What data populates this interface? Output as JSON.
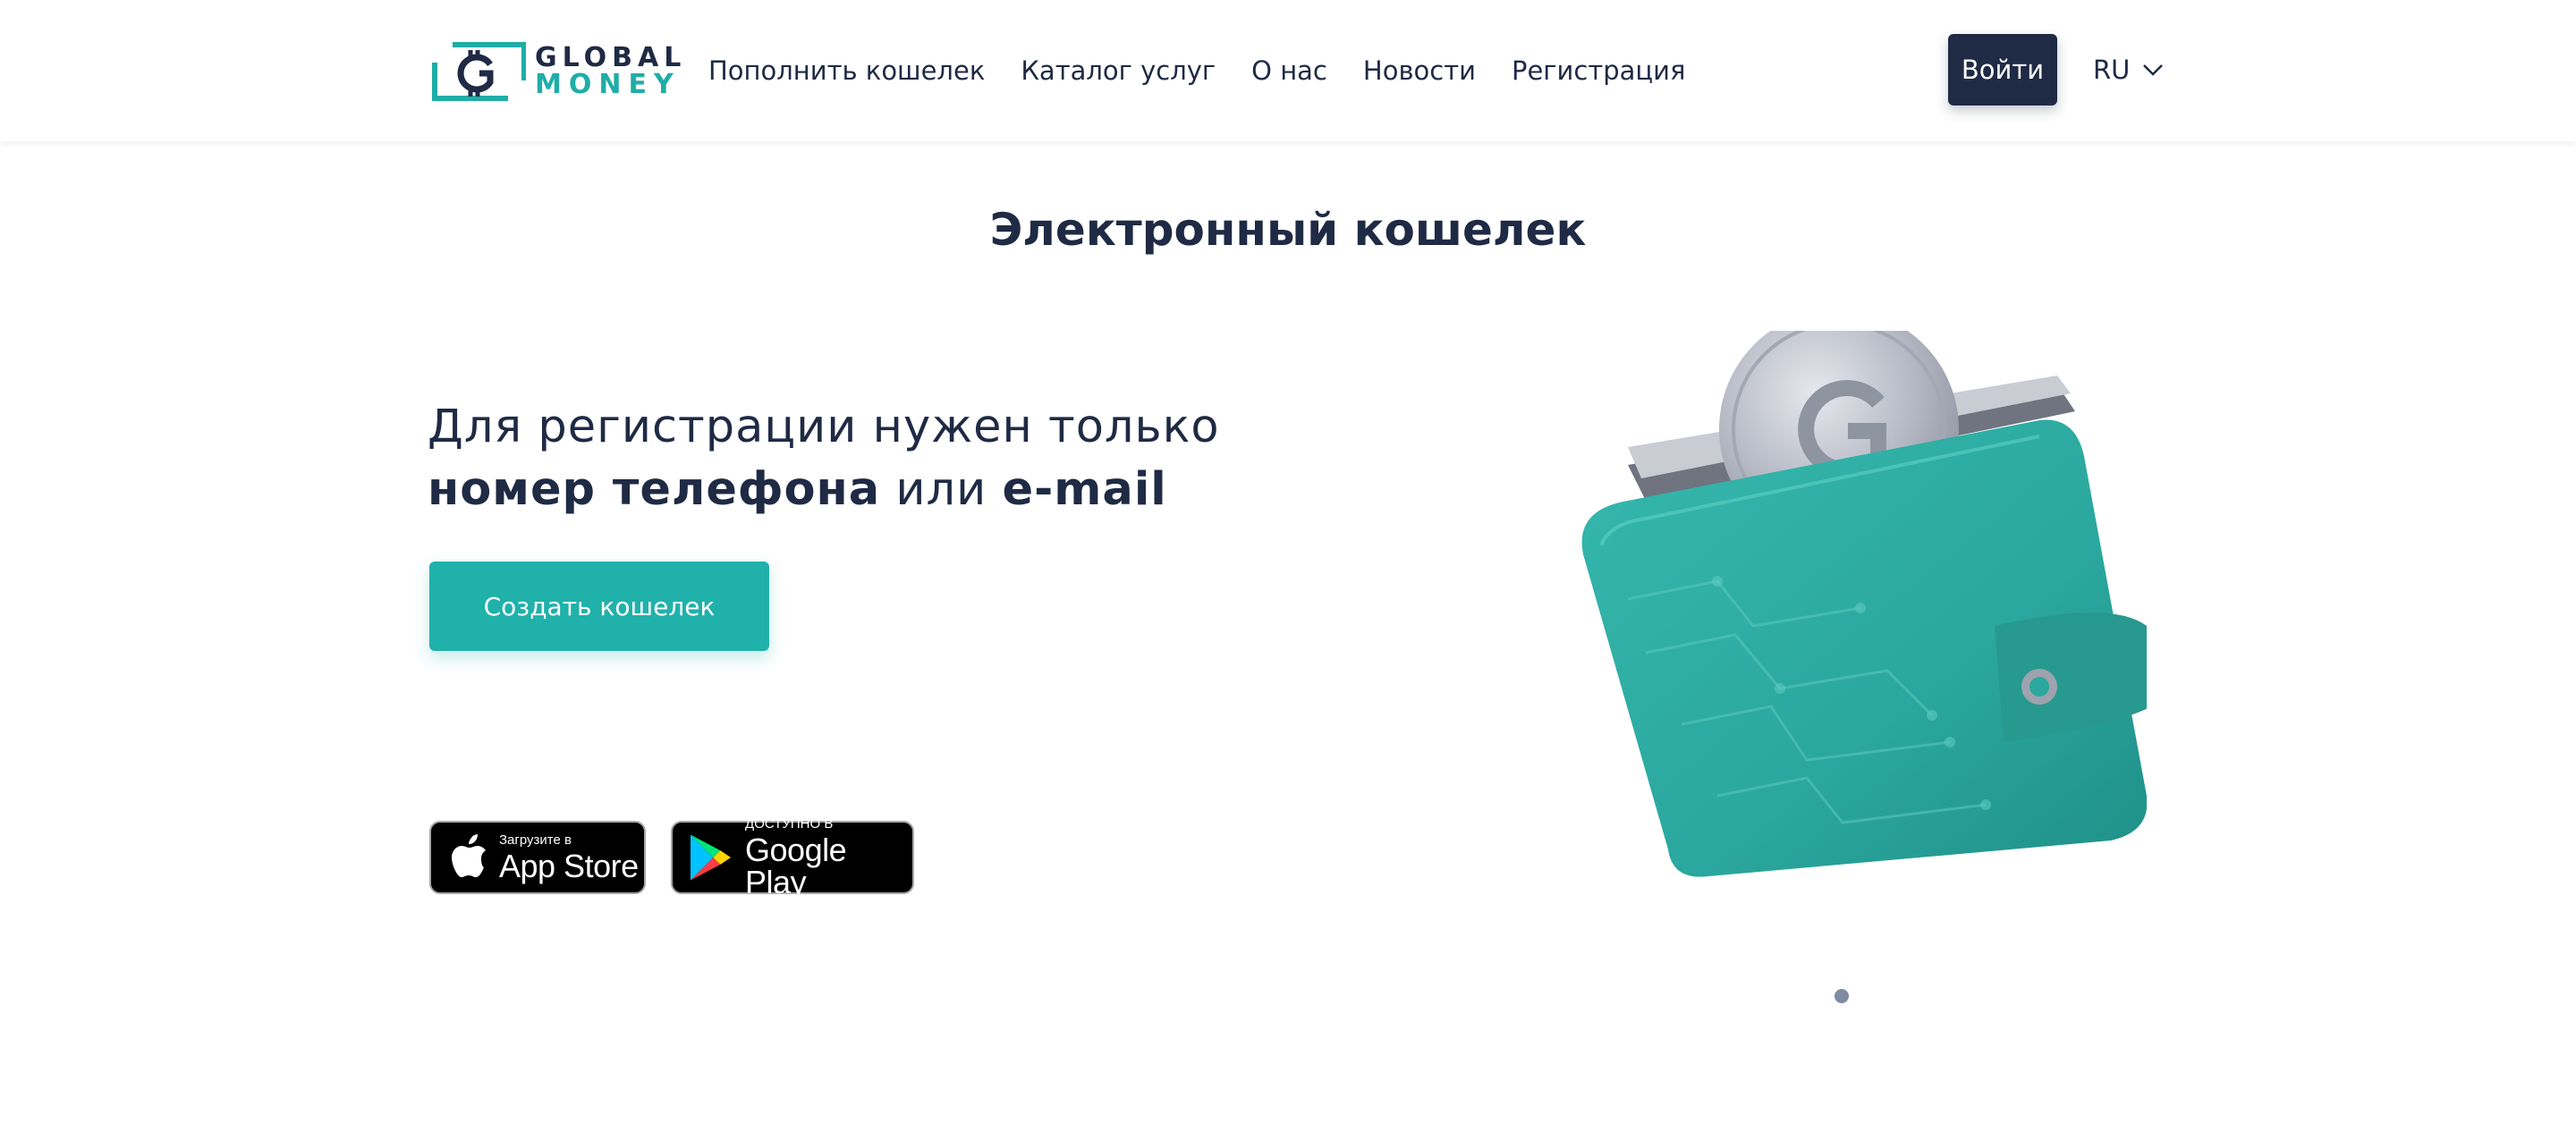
{
  "header": {
    "logo": {
      "line1": "GLOBAL",
      "line2": "MONEY"
    },
    "nav": [
      {
        "label": "Пополнить кошелек"
      },
      {
        "label": "Каталог услуг"
      },
      {
        "label": "О нас"
      },
      {
        "label": "Новости"
      },
      {
        "label": "Регистрация"
      }
    ],
    "login_label": "Войти",
    "language": "RU",
    "language_icon": "chevron-down-icon"
  },
  "main": {
    "title": "Электронный кошелек",
    "hero": {
      "line1": "Для регистрации нужен только",
      "line2_bold1": "номер телефона",
      "line2_mid": " или ",
      "line2_bold2": "e-mail"
    },
    "create_label": "Создать кошелек",
    "app_store": {
      "small": "Загрузите в",
      "big": "App Store",
      "icon": "apple-icon"
    },
    "google_play": {
      "small": "ДОСТУПНО В",
      "big": "Google Play",
      "icon": "google-play-icon"
    },
    "carousel": {
      "count": 1,
      "active": 1
    }
  },
  "colors": {
    "navy": "#1f2a44",
    "teal": "#20b1ab",
    "wallet": "#2aa79e",
    "coin": "#b9bcc6"
  }
}
